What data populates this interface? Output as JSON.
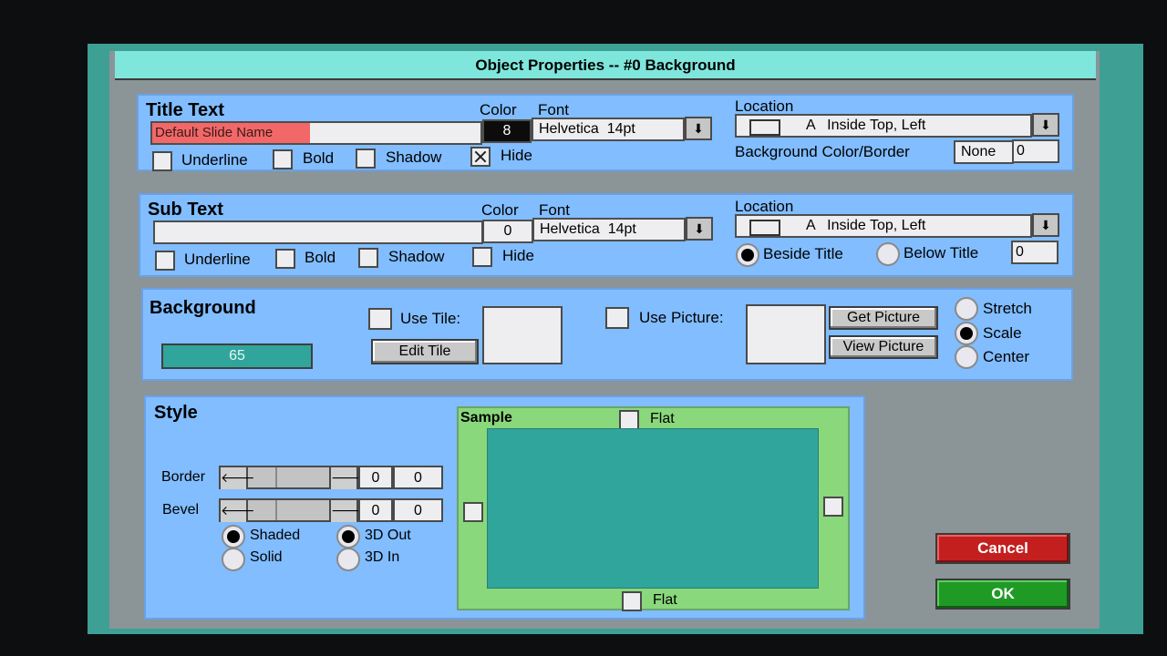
{
  "dialog": {
    "title": "Object Properties -- #0 Background"
  },
  "title_text": {
    "heading": "Title Text",
    "value": "Default Slide Name",
    "color_label": "Color",
    "font_label": "Font",
    "color_value": "8",
    "font_value": "Helvetica  14pt",
    "underline": "Underline",
    "bold": "Bold",
    "shadow": "Shadow",
    "hide": "Hide",
    "location_label": "Location",
    "location_value": "A   Inside Top, Left",
    "bg_border_label": "Background Color/Border",
    "bg_value": "None",
    "border_value": "0"
  },
  "sub_text": {
    "heading": "Sub Text",
    "color_label": "Color",
    "font_label": "Font",
    "color_value": "0",
    "font_value": "Helvetica  14pt",
    "underline": "Underline",
    "bold": "Bold",
    "shadow": "Shadow",
    "hide": "Hide",
    "location_label": "Location",
    "location_value": "A   Inside Top, Left",
    "beside": "Beside Title",
    "below": "Below Title",
    "offset_value": "0"
  },
  "background": {
    "heading": "Background",
    "color_value": "65",
    "use_tile": "Use Tile:",
    "edit_tile": "Edit Tile",
    "use_picture": "Use Picture:",
    "get_picture": "Get Picture",
    "view_picture": "View Picture",
    "stretch": "Stretch",
    "scale": "Scale",
    "center": "Center"
  },
  "style": {
    "heading": "Style",
    "border_label": "Border",
    "bevel_label": "Bevel",
    "border_a": "0",
    "border_b": "0",
    "bevel_a": "0",
    "bevel_b": "0",
    "shaded": "Shaded",
    "solid": "Solid",
    "out3d": "3D Out",
    "in3d": "3D In"
  },
  "sample": {
    "heading": "Sample",
    "flat_top": "Flat",
    "flat_bottom": "Flat"
  },
  "buttons": {
    "cancel": "Cancel",
    "ok": "OK"
  },
  "colors": {
    "panel": "#81bdff",
    "teal": "#30a59b",
    "sample_frame": "#8ad87c",
    "cancel": "#c41f1f",
    "ok": "#1f9a25",
    "title_highlight": "#f26868"
  }
}
